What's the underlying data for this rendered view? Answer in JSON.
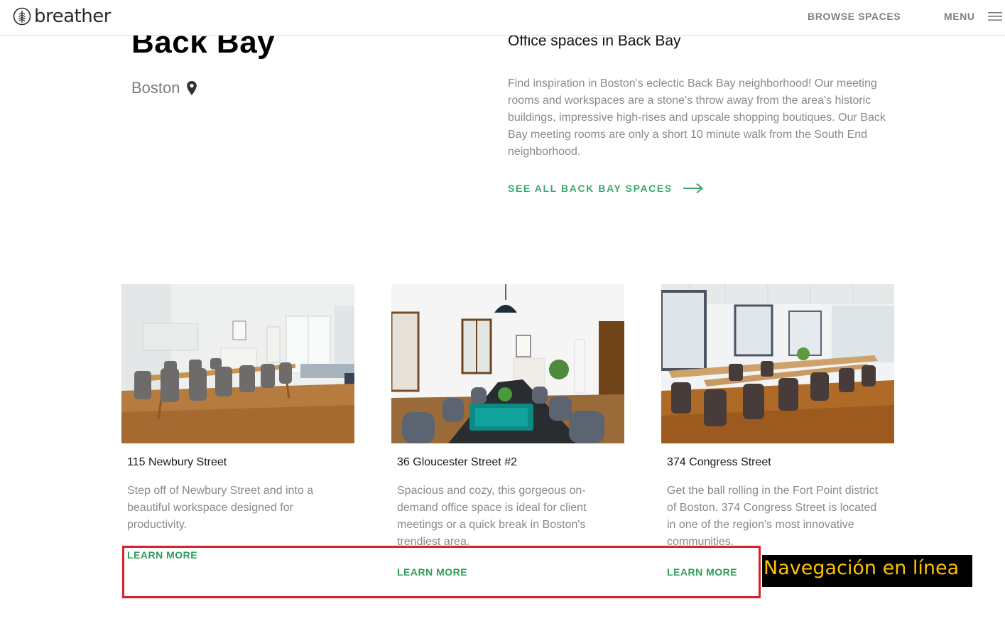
{
  "header": {
    "logo_text": "breather",
    "browse_label": "BROWSE SPACES",
    "menu_label": "MENU"
  },
  "hero": {
    "title": "Back Bay",
    "city": "Boston",
    "subtitle": "Office spaces in Back Bay",
    "description": "Find inspiration in Boston's eclectic Back Bay neighborhood! Our meeting rooms and workspaces are a stone's throw away from the area's historic buildings, impressive high-rises and upscale shopping boutiques. Our Back Bay meeting rooms are only a short 10 minute walk from the South End neighborhood.",
    "see_all_label": "SEE ALL BACK BAY SPACES"
  },
  "cards": [
    {
      "title": "115 Newbury Street",
      "description": "Step off of Newbury Street and into a beautiful workspace designed for productivity.",
      "link": "LEARN MORE"
    },
    {
      "title": "36 Gloucester Street #2",
      "description": "Spacious and cozy, this gorgeous on-demand office space is ideal for client meetings or a quick break in Boston's trendiest area.",
      "link": "LEARN MORE"
    },
    {
      "title": "374 Congress Street",
      "description": "Get the ball rolling in the Fort Point district of Boston. 374 Congress Street is located in one of the region's most innovative communities.",
      "link": "LEARN MORE"
    }
  ],
  "annotation": {
    "label": "Navegación en línea"
  },
  "colors": {
    "accent_green": "#3aa970",
    "link_green": "#2e9d57",
    "highlight_red": "#d8202a",
    "annotation_text": "#ffc000"
  },
  "icons": [
    "tree-logo-icon",
    "hamburger-menu-icon",
    "location-pin-icon",
    "arrow-right-icon"
  ]
}
